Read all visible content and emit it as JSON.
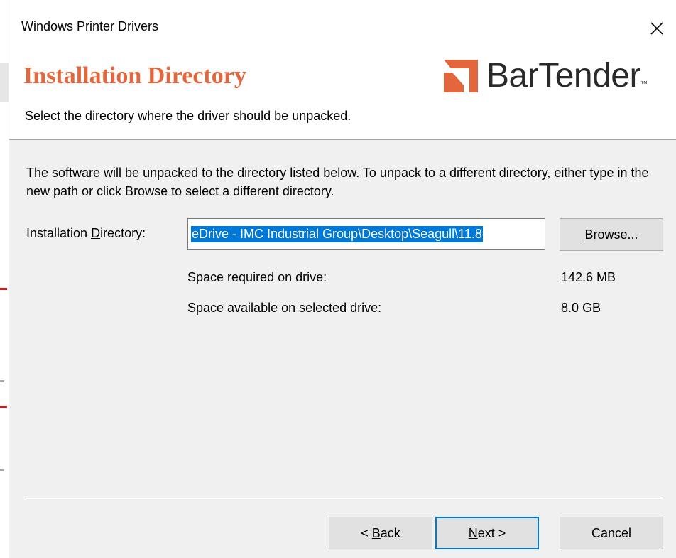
{
  "window": {
    "title": "Windows Printer Drivers",
    "close_icon": "close-icon"
  },
  "header": {
    "heading": "Installation Directory",
    "subheading": "Select the directory where the driver should be unpacked.",
    "logo_text": "BarTender",
    "logo_tm": "™",
    "logo_color": "#e3663c"
  },
  "body": {
    "description": "The software will be unpacked to the directory listed below.  To unpack to a different directory, either type in the new path or click Browse to select a different directory.",
    "dir_label_pre": "Installation ",
    "dir_label_key": "D",
    "dir_label_post": "irectory:",
    "dir_value": "eDrive - IMC Industrial Group\\Desktop\\Seagull\\11.8",
    "browse_key": "B",
    "browse_rest": "rowse...",
    "space_required_label": "Space required on drive:",
    "space_required_value": "142.6 MB",
    "space_available_label": "Space available on selected drive:",
    "space_available_value": "8.0 GB"
  },
  "footer": {
    "back_prefix": "< ",
    "back_key": "B",
    "back_rest": "ack",
    "next_key": "N",
    "next_rest": "ext >",
    "cancel_label": "Cancel"
  },
  "colors": {
    "accent": "#e3663c",
    "selection": "#0078d7",
    "dialog_bg": "#f0f0f0"
  }
}
